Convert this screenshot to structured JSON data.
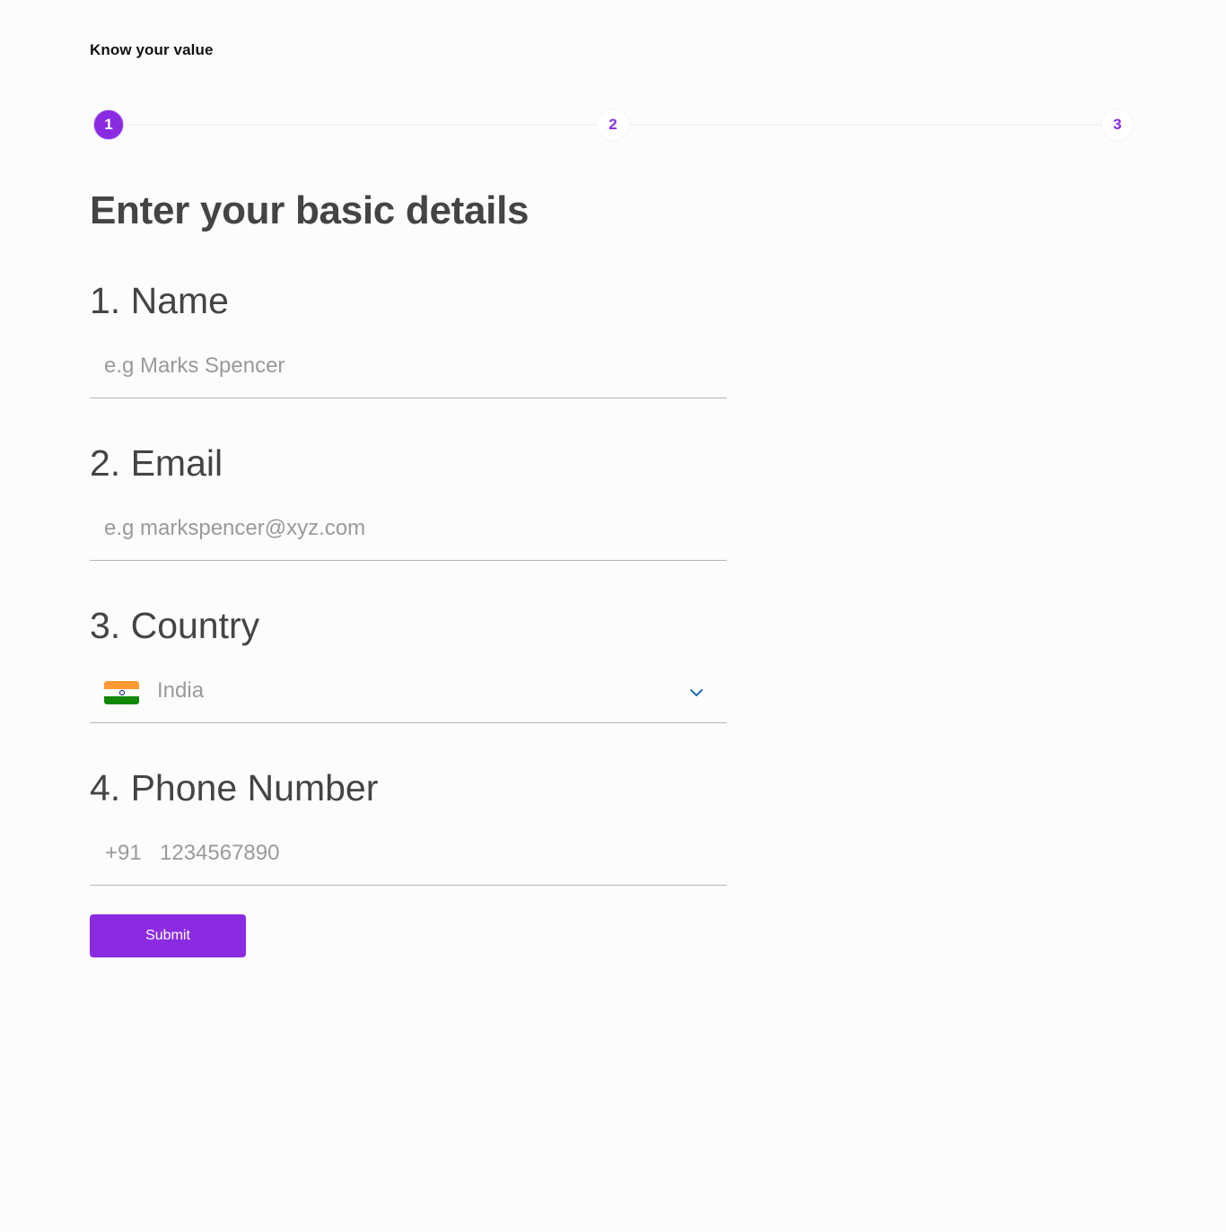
{
  "app": {
    "title": "Know your value"
  },
  "stepper": {
    "steps": [
      {
        "label": "1",
        "state": "active"
      },
      {
        "label": "2",
        "state": "inactive"
      },
      {
        "label": "3",
        "state": "inactive"
      }
    ],
    "accent_color": "#8a2be2"
  },
  "form": {
    "heading": "Enter your basic details",
    "name": {
      "label": "1. Name",
      "value": "",
      "placeholder": "e.g Marks Spencer"
    },
    "email": {
      "label": "2. Email",
      "value": "",
      "placeholder": "e.g markspencer@xyz.com"
    },
    "country": {
      "label": "3. Country",
      "selected": "India",
      "flag_icon": "india-flag-icon",
      "dropdown_icon": "chevron-down-icon"
    },
    "phone": {
      "label": "4. Phone Number",
      "country_code": "+91",
      "value": "",
      "placeholder": "1234567890"
    },
    "submit_label": "Submit"
  }
}
